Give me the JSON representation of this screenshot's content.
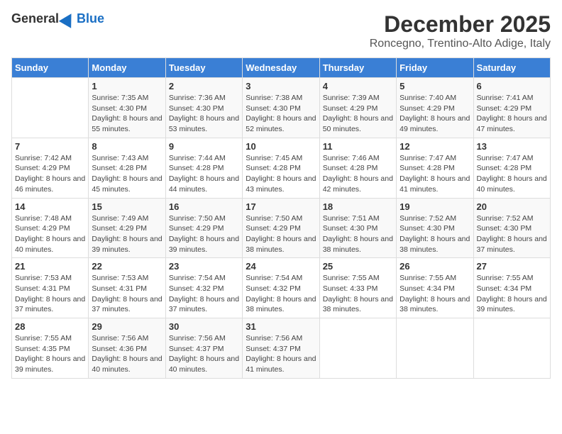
{
  "logo": {
    "general": "General",
    "blue": "Blue"
  },
  "title": "December 2025",
  "subtitle": "Roncegno, Trentino-Alto Adige, Italy",
  "days_of_week": [
    "Sunday",
    "Monday",
    "Tuesday",
    "Wednesday",
    "Thursday",
    "Friday",
    "Saturday"
  ],
  "weeks": [
    [
      {
        "num": "",
        "sunrise": "",
        "sunset": "",
        "daylight": ""
      },
      {
        "num": "1",
        "sunrise": "7:35 AM",
        "sunset": "4:30 PM",
        "daylight": "8 hours and 55 minutes."
      },
      {
        "num": "2",
        "sunrise": "7:36 AM",
        "sunset": "4:30 PM",
        "daylight": "8 hours and 53 minutes."
      },
      {
        "num": "3",
        "sunrise": "7:38 AM",
        "sunset": "4:30 PM",
        "daylight": "8 hours and 52 minutes."
      },
      {
        "num": "4",
        "sunrise": "7:39 AM",
        "sunset": "4:29 PM",
        "daylight": "8 hours and 50 minutes."
      },
      {
        "num": "5",
        "sunrise": "7:40 AM",
        "sunset": "4:29 PM",
        "daylight": "8 hours and 49 minutes."
      },
      {
        "num": "6",
        "sunrise": "7:41 AM",
        "sunset": "4:29 PM",
        "daylight": "8 hours and 47 minutes."
      }
    ],
    [
      {
        "num": "7",
        "sunrise": "7:42 AM",
        "sunset": "4:29 PM",
        "daylight": "8 hours and 46 minutes."
      },
      {
        "num": "8",
        "sunrise": "7:43 AM",
        "sunset": "4:28 PM",
        "daylight": "8 hours and 45 minutes."
      },
      {
        "num": "9",
        "sunrise": "7:44 AM",
        "sunset": "4:28 PM",
        "daylight": "8 hours and 44 minutes."
      },
      {
        "num": "10",
        "sunrise": "7:45 AM",
        "sunset": "4:28 PM",
        "daylight": "8 hours and 43 minutes."
      },
      {
        "num": "11",
        "sunrise": "7:46 AM",
        "sunset": "4:28 PM",
        "daylight": "8 hours and 42 minutes."
      },
      {
        "num": "12",
        "sunrise": "7:47 AM",
        "sunset": "4:28 PM",
        "daylight": "8 hours and 41 minutes."
      },
      {
        "num": "13",
        "sunrise": "7:47 AM",
        "sunset": "4:28 PM",
        "daylight": "8 hours and 40 minutes."
      }
    ],
    [
      {
        "num": "14",
        "sunrise": "7:48 AM",
        "sunset": "4:29 PM",
        "daylight": "8 hours and 40 minutes."
      },
      {
        "num": "15",
        "sunrise": "7:49 AM",
        "sunset": "4:29 PM",
        "daylight": "8 hours and 39 minutes."
      },
      {
        "num": "16",
        "sunrise": "7:50 AM",
        "sunset": "4:29 PM",
        "daylight": "8 hours and 39 minutes."
      },
      {
        "num": "17",
        "sunrise": "7:50 AM",
        "sunset": "4:29 PM",
        "daylight": "8 hours and 38 minutes."
      },
      {
        "num": "18",
        "sunrise": "7:51 AM",
        "sunset": "4:30 PM",
        "daylight": "8 hours and 38 minutes."
      },
      {
        "num": "19",
        "sunrise": "7:52 AM",
        "sunset": "4:30 PM",
        "daylight": "8 hours and 38 minutes."
      },
      {
        "num": "20",
        "sunrise": "7:52 AM",
        "sunset": "4:30 PM",
        "daylight": "8 hours and 37 minutes."
      }
    ],
    [
      {
        "num": "21",
        "sunrise": "7:53 AM",
        "sunset": "4:31 PM",
        "daylight": "8 hours and 37 minutes."
      },
      {
        "num": "22",
        "sunrise": "7:53 AM",
        "sunset": "4:31 PM",
        "daylight": "8 hours and 37 minutes."
      },
      {
        "num": "23",
        "sunrise": "7:54 AM",
        "sunset": "4:32 PM",
        "daylight": "8 hours and 37 minutes."
      },
      {
        "num": "24",
        "sunrise": "7:54 AM",
        "sunset": "4:32 PM",
        "daylight": "8 hours and 38 minutes."
      },
      {
        "num": "25",
        "sunrise": "7:55 AM",
        "sunset": "4:33 PM",
        "daylight": "8 hours and 38 minutes."
      },
      {
        "num": "26",
        "sunrise": "7:55 AM",
        "sunset": "4:34 PM",
        "daylight": "8 hours and 38 minutes."
      },
      {
        "num": "27",
        "sunrise": "7:55 AM",
        "sunset": "4:34 PM",
        "daylight": "8 hours and 39 minutes."
      }
    ],
    [
      {
        "num": "28",
        "sunrise": "7:55 AM",
        "sunset": "4:35 PM",
        "daylight": "8 hours and 39 minutes."
      },
      {
        "num": "29",
        "sunrise": "7:56 AM",
        "sunset": "4:36 PM",
        "daylight": "8 hours and 40 minutes."
      },
      {
        "num": "30",
        "sunrise": "7:56 AM",
        "sunset": "4:37 PM",
        "daylight": "8 hours and 40 minutes."
      },
      {
        "num": "31",
        "sunrise": "7:56 AM",
        "sunset": "4:37 PM",
        "daylight": "8 hours and 41 minutes."
      },
      {
        "num": "",
        "sunrise": "",
        "sunset": "",
        "daylight": ""
      },
      {
        "num": "",
        "sunrise": "",
        "sunset": "",
        "daylight": ""
      },
      {
        "num": "",
        "sunrise": "",
        "sunset": "",
        "daylight": ""
      }
    ]
  ]
}
